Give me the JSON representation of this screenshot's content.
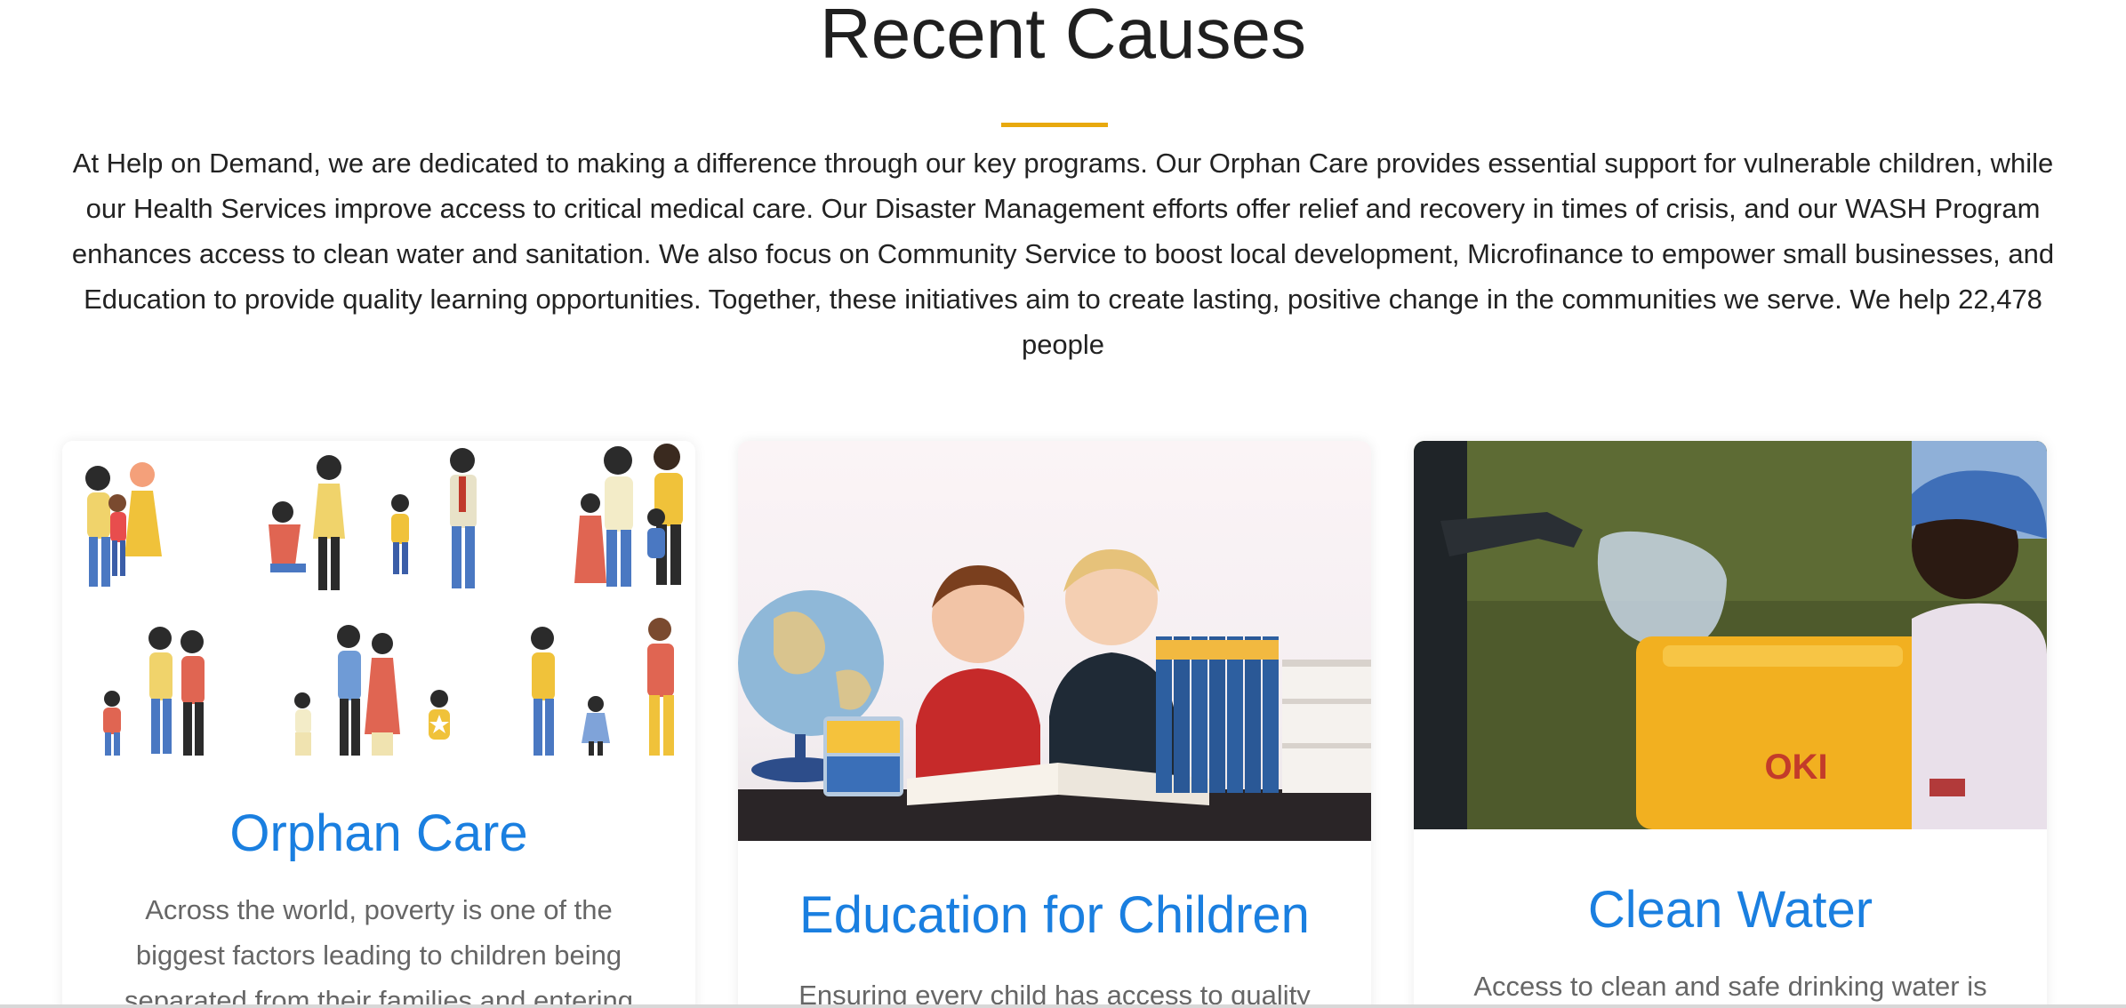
{
  "section": {
    "title": "Recent Causes",
    "accent_color": "#e8a90e",
    "intro": "At Help on Demand, we are dedicated to making a difference through our key programs. Our Orphan Care provides essential support for vulnerable children, while our Health Services improve access to critical medical care. Our Disaster Management efforts offer relief and recovery in times of crisis, and our WASH Program enhances access to clean water and sanitation. We also focus on Community Service to boost local development, Microfinance to empower small businesses, and Education to provide quality learning opportunities. Together, these initiatives aim to create lasting, positive change in the communities we serve. We help 22,478 people"
  },
  "causes": [
    {
      "title": "Orphan Care",
      "text": "Across the world, poverty is one of the biggest factors leading to children being separated from their families and entering",
      "image_icon": "families-illustration-icon"
    },
    {
      "title": "Education for Children",
      "text": "Ensuring every child has access to quality",
      "image_icon": "children-with-books-photo-icon"
    },
    {
      "title": "Clean Water",
      "text": "Access to clean and safe drinking water is",
      "image_icon": "water-jerrycan-photo-icon"
    }
  ],
  "title_color": "#1a7fe0"
}
